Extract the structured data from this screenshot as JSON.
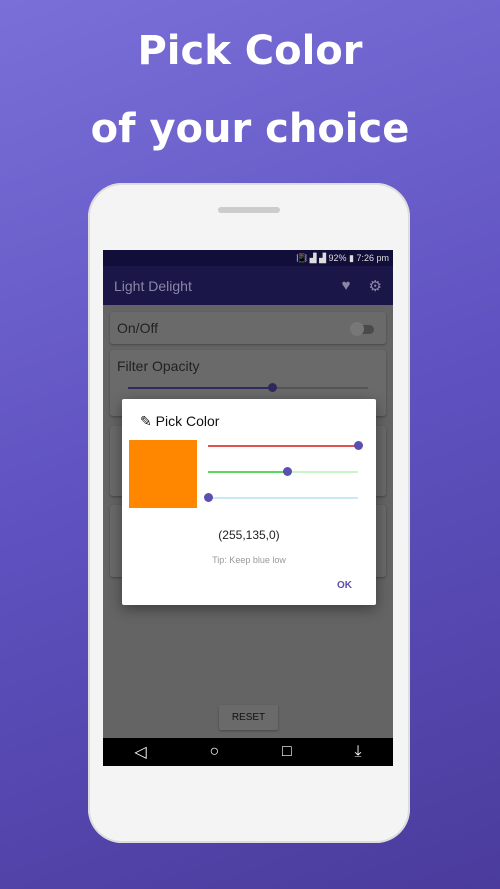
{
  "headline": {
    "line1": "Pick Color",
    "line2": "of your choice"
  },
  "status_bar": {
    "text": "📳 ▟ ▟ 92% ▮ 7:26 pm"
  },
  "app_bar": {
    "title": "Light Delight",
    "icons": [
      "heart-icon",
      "gear-icon"
    ]
  },
  "cards": {
    "on_off": "On/Off",
    "filter_opacity": "Filter Opacity",
    "filter_opacity_value": 0.6
  },
  "reset_label": "RESET",
  "dialog": {
    "title": "Pick Color",
    "icon": "eyedropper-icon",
    "color": "#ff8700",
    "red": 255,
    "green": 135,
    "blue": 0,
    "rgb_text": "(255,135,0)",
    "tip": "Tip: Keep blue low",
    "ok_label": "OK"
  },
  "nav": {
    "icons": [
      "back-icon",
      "home-icon",
      "recents-icon",
      "download-icon"
    ]
  }
}
